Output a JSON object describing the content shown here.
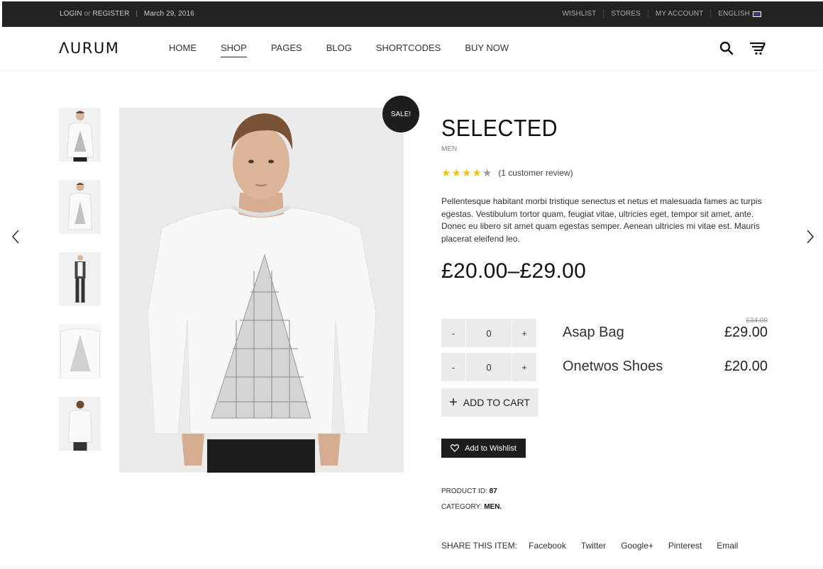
{
  "topbar": {
    "login": "LOGIN",
    "or": "or",
    "register": "REGISTER",
    "date": "March 29, 2016",
    "links": [
      "WISHLIST",
      "STORES",
      "MY ACCOUNT",
      "ENGLISH"
    ]
  },
  "header": {
    "logo": "ΛURUM",
    "nav": [
      "HOME",
      "SHOP",
      "PAGES",
      "BLOG",
      "SHORTCODES",
      "BUY NOW"
    ],
    "active_nav": "SHOP"
  },
  "product": {
    "badge": "SALE!",
    "title": "SELECTED",
    "category_tag": "MEN",
    "rating": 4,
    "rating_max": 5,
    "review_text": "(1 customer review)",
    "description": "Pellentesque habitant morbi tristique senectus et netus et malesuada fames ac turpis egestas. Vestibulum tortor quam, feugiat vitae, ultricies eget, tempor sit amet, ante. Donec eu libero sit amet quam egestas semper. Aenean ultricies mi vitae est. Mauris placerat eleifend leo.",
    "price_range": "£20.00–£29.00",
    "grouped": [
      {
        "qty": "0",
        "minus": "-",
        "plus": "+",
        "name": "Asap Bag",
        "old_price": "£34.00",
        "price": "£29.00"
      },
      {
        "qty": "0",
        "minus": "-",
        "plus": "+",
        "name": "Onetwos Shoes",
        "old_price": "",
        "price": "£20.00"
      }
    ],
    "add_to_cart": "ADD TO CART",
    "wishlist": "Add to Wishlist",
    "product_id_label": "PRODUCT ID:",
    "product_id": "87",
    "category_label": "CATEGORY:",
    "category": "MEN."
  },
  "share": {
    "label": "SHARE THIS ITEM:",
    "links": [
      "Facebook",
      "Twitter",
      "Google+",
      "Pinterest",
      "Email"
    ]
  },
  "colors": {
    "topbar_bg": "#222222",
    "badge_bg": "#1d1d1d",
    "star": "#f4c20d",
    "button_bg": "#ececec"
  }
}
